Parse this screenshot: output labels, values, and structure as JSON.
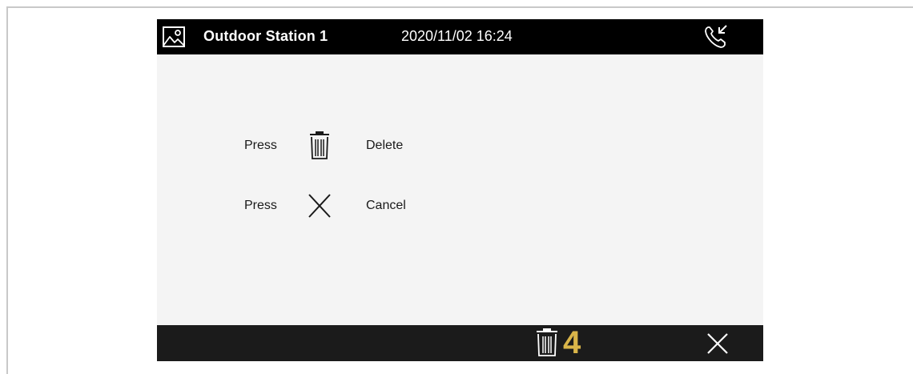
{
  "header": {
    "station_name": "Outdoor Station 1",
    "datetime": "2020/11/02 16:24",
    "left_icon": "gallery-icon",
    "right_icon": "incoming-call-icon"
  },
  "instructions": [
    {
      "prefix": "Press",
      "icon": "trash-icon",
      "action": "Delete"
    },
    {
      "prefix": "Press",
      "icon": "close-icon",
      "action": "Cancel"
    }
  ],
  "bottombar": {
    "delete_icon": "trash-icon",
    "delete_count": "4",
    "close_icon": "close-icon",
    "count_color": "#d9b549"
  },
  "colors": {
    "titlebar": "#000000",
    "bottombar": "#1b1b1b",
    "screen_background": "#f4f4f4"
  }
}
